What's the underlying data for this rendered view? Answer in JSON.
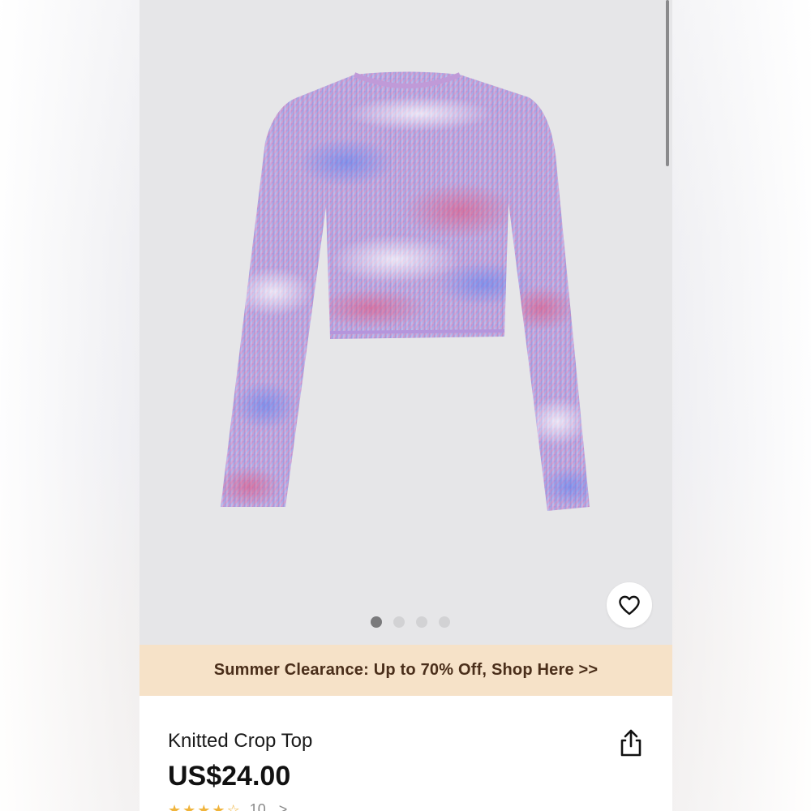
{
  "gallery": {
    "image_alt": "knitted-crop-top-photo",
    "dots": [
      true,
      false,
      false,
      false
    ],
    "favorite_icon": "heart-icon"
  },
  "banner": {
    "text": "Summer Clearance: Up to 70% Off, Shop Here >>"
  },
  "product": {
    "title": "Knitted Crop Top",
    "price": "US$24.00",
    "share_icon": "share-icon",
    "rating": 4.5,
    "review_count": "10",
    "chevron": ">"
  },
  "colors": {
    "banner_bg": "#f6e2c8",
    "banner_text": "#4a2e1a",
    "gallery_bg": "#e6e6e8",
    "star": "#f0b43c"
  }
}
